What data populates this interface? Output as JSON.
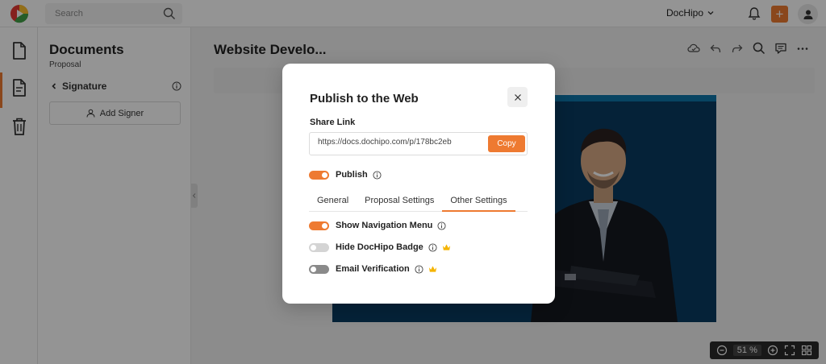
{
  "topbar": {
    "search_placeholder": "Search",
    "workspace_label": "DocHipo",
    "plus_label": "+",
    "logo_icon": "dochipo-logo-icon",
    "accent_color": "#ee7a31"
  },
  "rail": {
    "items": [
      {
        "name": "documents",
        "icon": "document-icon"
      },
      {
        "name": "proposal",
        "icon": "document-lines-icon",
        "active": true
      },
      {
        "name": "trash",
        "icon": "trash-icon"
      }
    ]
  },
  "panel": {
    "title": "Documents",
    "subtitle": "Proposal",
    "section_label": "Signature",
    "add_signer_label": "Add Signer"
  },
  "canvas": {
    "doc_title": "Website Develo...",
    "zoom_value": "51",
    "zoom_unit": "%"
  },
  "modal": {
    "title": "Publish to the Web",
    "share_label": "Share Link",
    "share_url": "https://docs.dochipo.com/p/178bc2eb",
    "copy_label": "Copy",
    "publish_label": "Publish",
    "publish_on": true,
    "tabs": [
      {
        "label": "General",
        "active": false
      },
      {
        "label": "Proposal Settings",
        "active": false
      },
      {
        "label": "Other Settings",
        "active": true
      }
    ],
    "settings": [
      {
        "label": "Show Navigation Menu",
        "on": true,
        "premium": false
      },
      {
        "label": "Hide DocHipo Badge",
        "on": false,
        "premium": true
      },
      {
        "label": "Email Verification",
        "on": false,
        "premium": true
      }
    ]
  }
}
